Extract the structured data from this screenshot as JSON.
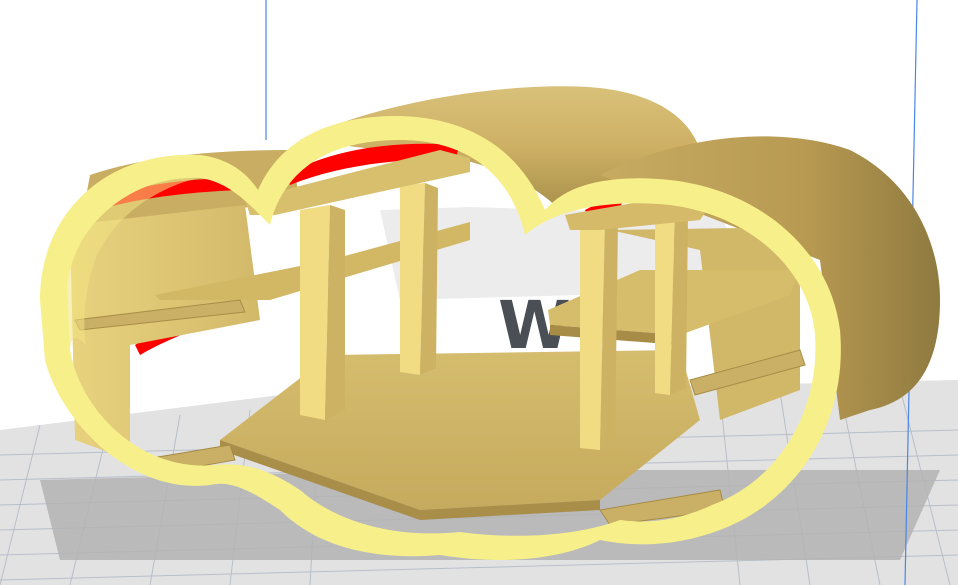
{
  "viewport": {
    "background": "#ffffff",
    "build_plate_color": "#e2e2e2",
    "grid_line_color": "#b8bfc9",
    "axis_line_color": "#4a86e8"
  },
  "model": {
    "outer_shell_color": "#f7f08a",
    "inner_wall_color": "#e6cf7a",
    "shaded_wall_color": "#c7ab62",
    "overhang_color": "#ff0000"
  },
  "plate_logo": {
    "text": "W",
    "color": "#4a4e55"
  }
}
